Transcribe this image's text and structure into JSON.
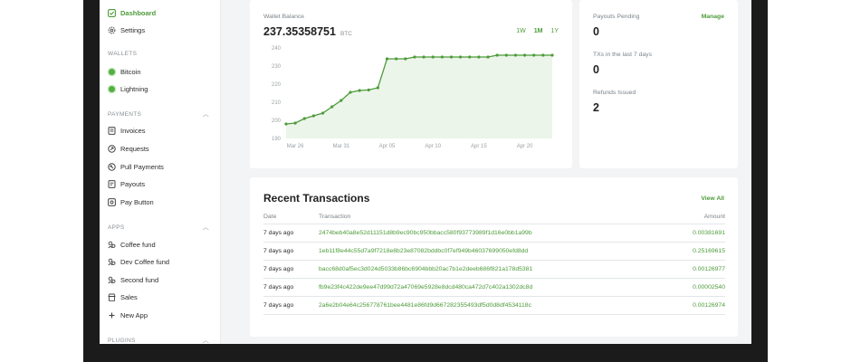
{
  "sidebar": {
    "top_items": [
      {
        "label": "Dashboard",
        "icon": "dashboard-icon",
        "active": true
      },
      {
        "label": "Settings",
        "icon": "gear-icon",
        "active": false
      }
    ],
    "wallets_heading": "WALLETS",
    "wallets": [
      {
        "label": "Bitcoin",
        "icon": "status-dot-icon"
      },
      {
        "label": "Lightning",
        "icon": "status-dot-icon"
      }
    ],
    "payments_heading": "PAYMENTS",
    "payments": [
      {
        "label": "Invoices",
        "icon": "invoice-icon"
      },
      {
        "label": "Requests",
        "icon": "request-icon"
      },
      {
        "label": "Pull Payments",
        "icon": "pull-payment-icon"
      },
      {
        "label": "Payouts",
        "icon": "payout-icon"
      },
      {
        "label": "Pay Button",
        "icon": "pay-button-icon"
      }
    ],
    "apps_heading": "APPS",
    "apps": [
      {
        "label": "Coffee fund",
        "icon": "crowdfund-icon"
      },
      {
        "label": "Dev Coffee fund",
        "icon": "crowdfund-icon"
      },
      {
        "label": "Second fund",
        "icon": "crowdfund-icon"
      },
      {
        "label": "Sales",
        "icon": "store-icon"
      },
      {
        "label": "New App",
        "icon": "plus-icon"
      }
    ],
    "plugins_heading": "PLUGINS"
  },
  "balance": {
    "label": "Wallet Balance",
    "amount": "237.35358751",
    "unit": "BTC",
    "ranges": [
      "1W",
      "1M",
      "1Y"
    ],
    "active_range": "1M"
  },
  "chart_data": {
    "type": "area",
    "x": [
      "Mar 25",
      "Mar 26",
      "Mar 27",
      "Mar 28",
      "Mar 29",
      "Mar 30",
      "Mar 31",
      "Apr 01",
      "Apr 02",
      "Apr 03",
      "Apr 04",
      "Apr 05",
      "Apr 06",
      "Apr 07",
      "Apr 08",
      "Apr 09",
      "Apr 10",
      "Apr 11",
      "Apr 12",
      "Apr 13",
      "Apr 14",
      "Apr 15",
      "Apr 16",
      "Apr 17",
      "Apr 18",
      "Apr 19",
      "Apr 20",
      "Apr 21",
      "Apr 22",
      "Apr 23"
    ],
    "values": [
      198,
      198.5,
      201,
      202.5,
      204,
      207.5,
      211,
      215.5,
      216.5,
      216.8,
      218,
      234,
      234,
      234,
      235,
      235,
      235,
      235,
      235,
      235,
      235,
      235,
      235,
      236,
      236,
      236,
      236,
      236,
      236,
      236
    ],
    "x_ticks": [
      "Mar 26",
      "Mar 31",
      "Apr 05",
      "Apr 10",
      "Apr 15",
      "Apr 20"
    ],
    "y_ticks": [
      190,
      200,
      210,
      220,
      230,
      240
    ],
    "ylim": [
      190,
      240
    ],
    "line_color": "#4d9b3a",
    "fill_color": "#ecf5ea",
    "grid": false
  },
  "stats": {
    "payouts_pending_label": "Payouts Pending",
    "manage_label": "Manage",
    "payouts_pending_value": "0",
    "txs_label": "TXs in the last 7 days",
    "txs_value": "0",
    "refunds_label": "Refunds Issued",
    "refunds_value": "2"
  },
  "transactions": {
    "title": "Recent Transactions",
    "view_all": "View All",
    "columns": [
      "Date",
      "Transaction",
      "Amount"
    ],
    "rows": [
      {
        "date": "7 days ago",
        "tx": "2474beb40a8e52d11151d8b9ec90bc950bbacc580f93773989f1d16e0bb1a99b",
        "amount": "0.00381691"
      },
      {
        "date": "7 days ago",
        "tx": "1eb11f8e44c55d7a9f7218e8b23e87082bddbc0f7ef949b46037699050efd8dd",
        "amount": "0.25169615"
      },
      {
        "date": "7 days ago",
        "tx": "bacc68d0af5ec3d024d5033b86bc6904bbb20ac7b1e2deeb686f821a178d5381",
        "amount": "0.00126977"
      },
      {
        "date": "7 days ago",
        "tx": "fb9e23f4c422de9ee47d99d72a47069e5928e8dcd480ca472d7c402a1302dc8d",
        "amount": "0.00002540"
      },
      {
        "date": "7 days ago",
        "tx": "2a6e2b04e64c256778761bee4481e86fd9d667282355493df5d0d8df4534118c",
        "amount": "0.00126974"
      }
    ]
  },
  "colors": {
    "accent": "#4d9b3a",
    "frame": "#1b1b1b",
    "background": "#f2f4f5"
  }
}
